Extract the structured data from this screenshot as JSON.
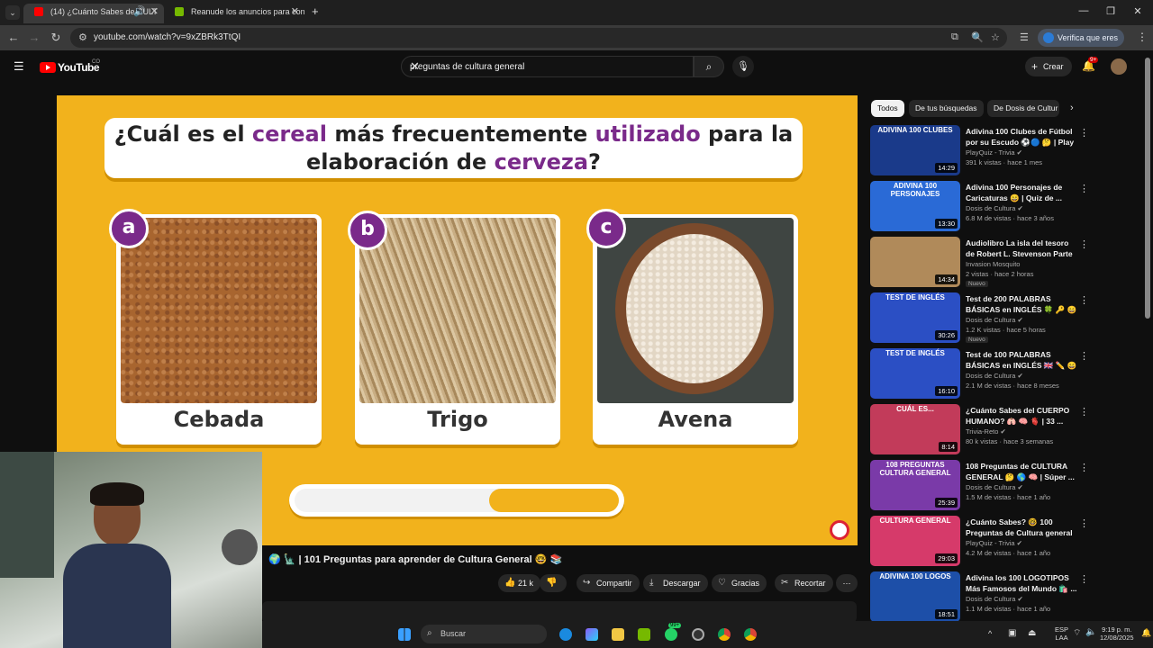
{
  "browser": {
    "tabs": [
      {
        "title": "(14) ¿Cuánto Sabes de CULT",
        "active": true
      },
      {
        "title": "Reanude los anuncios para con",
        "active": false
      }
    ],
    "new_tab": "+",
    "url": "youtube.com/watch?v=9xZBRk3TtQI",
    "verify_label": "Verifica que eres tú",
    "window_controls": [
      "—",
      "❐",
      "✕"
    ]
  },
  "youtube": {
    "logo_text": "YouTube",
    "country": "CO",
    "search_value": "preguntas de cultura general",
    "create_label": "Crear",
    "notif_count": "9+"
  },
  "video": {
    "question_parts": [
      "¿Cuál es el ",
      "cereal",
      " más frecuentemente ",
      "utilizado",
      " para la",
      "elaboración de ",
      "cerveza",
      "?"
    ],
    "options": [
      {
        "letter": "a",
        "label": "Cebada"
      },
      {
        "letter": "b",
        "label": "Trigo"
      },
      {
        "letter": "c",
        "label": "Avena"
      }
    ],
    "timer_remaining": 0.4,
    "title": "🌍 🗽 | 101 Preguntas para aprender de Cultura General 🤓 📚",
    "likes": "21 k",
    "actions": [
      "Compartir",
      "Descargar",
      "Gracias",
      "Recortar"
    ],
    "more": "⋯"
  },
  "sidebar": {
    "chips": [
      "Todos",
      "De tus búsquedas",
      "De Dosis de Cultur"
    ],
    "recommendations": [
      {
        "title": "Adivina 100 Clubes de Fútbol por su Escudo ⚽🔵 🤔 | Play ...",
        "channel": "PlayQuiz - Trivia ✔",
        "meta": "391 k vistas · hace 1 mes",
        "duration": "14:29",
        "thumb_text": "ADIVINA 100 CLUBES",
        "color": "#1a3a8a",
        "new": ""
      },
      {
        "title": "Adivina 100 Personajes de Caricaturas 😄 | Quiz de ...",
        "channel": "Dosis de Cultura ✔",
        "meta": "6.8 M de vistas · hace 3 años",
        "duration": "13:30",
        "thumb_text": "ADIVINA 100 PERSONAJES",
        "color": "#2a6ad6",
        "new": ""
      },
      {
        "title": "Audiolibro La isla del tesoro de Robert L. Stevenson Parte 6 ...",
        "channel": "Invasion Mosquito",
        "meta": "2 vistas · hace 2 horas",
        "duration": "14:34",
        "thumb_text": "",
        "color": "#b08a5a",
        "new": "Nuevo"
      },
      {
        "title": "Test de 200 PALABRAS BÁSICAS en INGLÉS 🍀 🔑 😄 ...",
        "channel": "Dosis de Cultura ✔",
        "meta": "1.2 K vistas · hace 5 horas",
        "duration": "30:26",
        "thumb_text": "TEST DE INGLÉS",
        "color": "#2b4fc4",
        "new": "Nuevo"
      },
      {
        "title": "Test de 100 PALABRAS BÁSICAS en INGLÉS 🇬🇧 ✏️ 😄 ...",
        "channel": "Dosis de Cultura ✔",
        "meta": "2.1 M de vistas · hace 8 meses",
        "duration": "16:10",
        "thumb_text": "TEST DE INGLÉS",
        "color": "#2b4fc4",
        "new": ""
      },
      {
        "title": "¿Cuánto Sabes del CUERPO HUMANO? 🫁 🧠 🫀 | 33 ...",
        "channel": "Trivia-Reto ✔",
        "meta": "80 k vistas · hace 3 semanas",
        "duration": "8:14",
        "thumb_text": "CUÁL ES...",
        "color": "#c23b5a",
        "new": ""
      },
      {
        "title": "108 Preguntas de CULTURA GENERAL 🤔 🌎 🧠 | Súper ...",
        "channel": "Dosis de Cultura ✔",
        "meta": "1.5 M de vistas · hace 1 año",
        "duration": "25:39",
        "thumb_text": "108 PREGUNTAS CULTURA GENERAL",
        "color": "#7a3aa8",
        "new": ""
      },
      {
        "title": "¿Cuánto Sabes? 🤓 100 Preguntas de Cultura general ...",
        "channel": "PlayQuiz - Trivia ✔",
        "meta": "4.2 M de vistas · hace 1 año",
        "duration": "29:03",
        "thumb_text": "CULTURA GENERAL",
        "color": "#d63a6a",
        "new": ""
      },
      {
        "title": "Adivina los 100 LOGOTIPOS Más Famosos del Mundo 🛍️ ...",
        "channel": "Dosis de Cultura ✔",
        "meta": "1.1 M de vistas · hace 1 año",
        "duration": "18:51",
        "thumb_text": "ADIVINA 100 LOGOS",
        "color": "#1d4fa8",
        "new": ""
      }
    ]
  },
  "taskbar": {
    "search_placeholder": "Buscar",
    "badge": "99+",
    "lang": [
      "ESP",
      "LAA"
    ],
    "time": "9:19 p. m.",
    "date": "12/08/2025"
  },
  "colors": {
    "video_bg": "#f2b21c",
    "accent_purple": "#7a2a8a",
    "yt_red": "#ff0000"
  }
}
